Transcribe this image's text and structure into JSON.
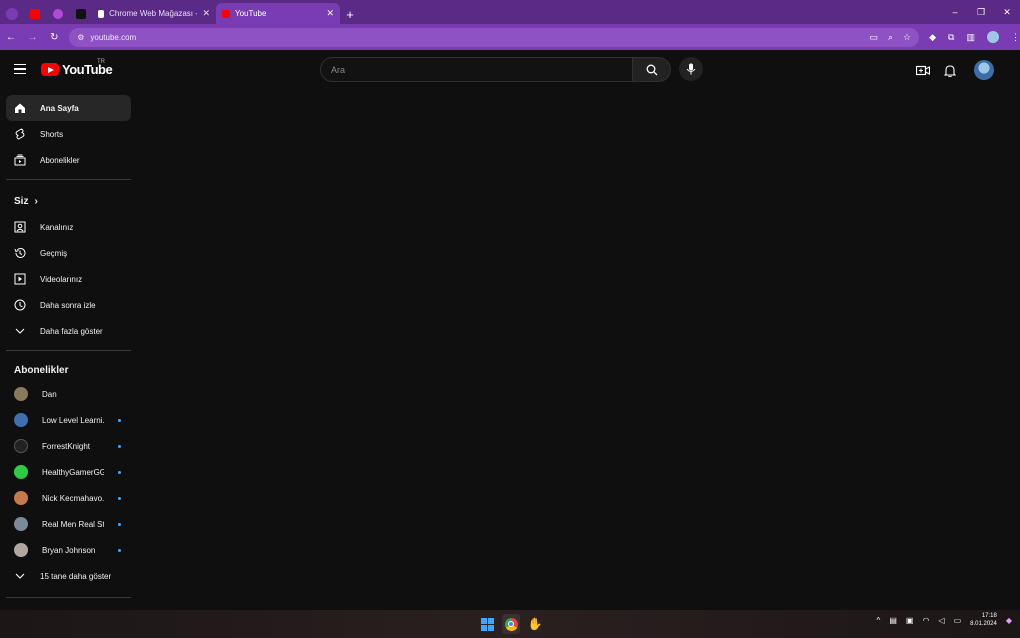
{
  "browser": {
    "tabs": [
      {
        "label": "Chrome Web Mağazası - Öğeler",
        "favicon_color": "#ffffff"
      },
      {
        "label": "YouTube",
        "favicon_color": "#ff0000"
      }
    ],
    "new_tab_symbol": "+",
    "url": "youtube.com",
    "window_controls": [
      "⌄",
      "–",
      "❐",
      "✕"
    ]
  },
  "youtube": {
    "logo_text": "YouTube",
    "country_code": "TR",
    "search_placeholder": "Ara"
  },
  "sidebar": {
    "main": [
      {
        "label": "Ana Sayfa",
        "icon": "home-icon",
        "active": true
      },
      {
        "label": "Shorts",
        "icon": "shorts-icon"
      },
      {
        "label": "Abonelikler",
        "icon": "subscriptions-icon"
      }
    ],
    "you_title": "Siz",
    "you_items": [
      {
        "label": "Kanalınız",
        "icon": "channel-icon"
      },
      {
        "label": "Geçmiş",
        "icon": "history-icon"
      },
      {
        "label": "Videolarınız",
        "icon": "videos-icon"
      },
      {
        "label": "Daha sonra izle",
        "icon": "watch-later-icon"
      },
      {
        "label": "Daha fazla göster",
        "icon": "chevron-down-icon"
      }
    ],
    "subs_title": "Abonelikler",
    "subscriptions": [
      {
        "label": "Dan",
        "color": "#8a7a5a",
        "new": false
      },
      {
        "label": "Low Level Learni...",
        "color": "#3e6fb0",
        "new": true
      },
      {
        "label": "ForrestKnight",
        "color": "#222222",
        "new": true
      },
      {
        "label": "HealthyGamerGG",
        "color": "#2ecc40",
        "new": true
      },
      {
        "label": "Nick Kecmahavo...",
        "color": "#c47a4a",
        "new": true
      },
      {
        "label": "Real Men Real St...",
        "color": "#7a8a9a",
        "new": true
      },
      {
        "label": "Bryan Johnson",
        "color": "#b0a8a0",
        "new": true
      }
    ],
    "show_more_subs": "15 tane daha göster"
  },
  "taskbar": {
    "time": "17:18",
    "date": "8.01.2024"
  }
}
